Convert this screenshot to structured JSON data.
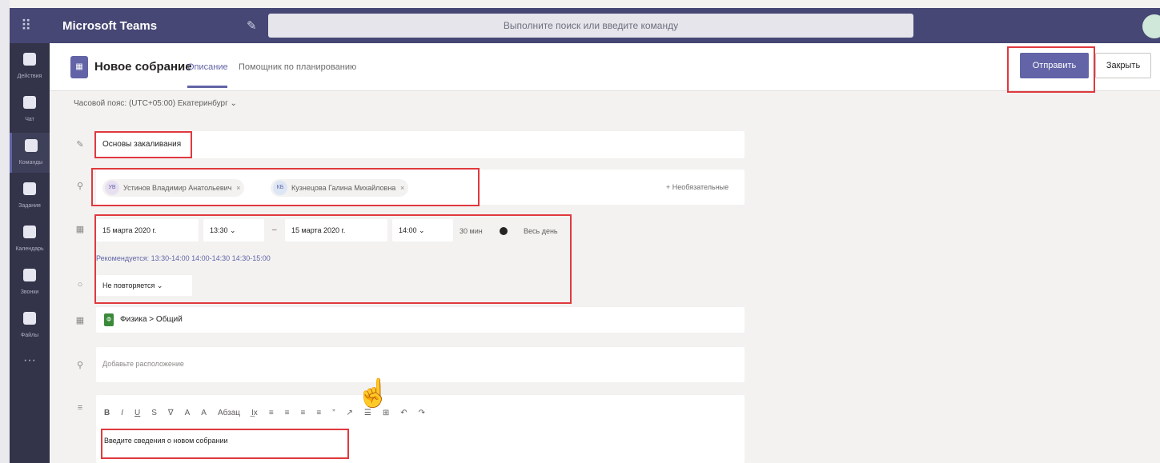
{
  "topbar": {
    "app_title": "Microsoft Teams",
    "search_placeholder": "Выполните поиск или введите команду"
  },
  "rail": {
    "items": [
      {
        "label": "Действия"
      },
      {
        "label": "Чат"
      },
      {
        "label": "Команды"
      },
      {
        "label": "Задания"
      },
      {
        "label": "Календарь"
      },
      {
        "label": "Звонки"
      },
      {
        "label": "Файлы"
      }
    ],
    "more": "···"
  },
  "header": {
    "title": "Новое собрание",
    "tabs": [
      "Описание",
      "Помощник по планированию"
    ],
    "send_label": "Отправить",
    "close_label": "Закрыть"
  },
  "timezone": "Часовой пояс: (UTC+05:00) Екатеринбург",
  "form": {
    "title_value": "Основы закаливания",
    "attendees": [
      {
        "initials": "УВ",
        "name": "Устинов Владимир Анатольевич"
      },
      {
        "initials": "КБ",
        "name": "Кузнецова Галина Михайловна"
      }
    ],
    "optional_label": "+ Необязательные",
    "start_date": "15 марта 2020 г.",
    "start_time": "13:30",
    "end_date": "15 марта 2020 г.",
    "end_time": "14:00",
    "duration": "30 мин",
    "all_day_label": "Весь день",
    "suggested_label": "Рекомендуется:",
    "suggested_times": "13:30-14:00  14:00-14:30  14:30-15:00",
    "repeat_value": "Не повторяется",
    "team": "Физика",
    "channel_separator": ">",
    "channel": "Общий",
    "location_placeholder": "Добавьте расположение",
    "editor_text": "Введите сведения о новом собрании"
  },
  "toolbar": [
    "B",
    "I",
    "U",
    "S",
    "∇",
    "A",
    "A",
    "Абзац",
    "I̲x",
    "≡",
    "≡",
    "≡",
    "≡",
    "”",
    "↗",
    "☰",
    "⊞",
    "↶",
    "↷"
  ],
  "colors": {
    "brand": "#6264a7",
    "topbar": "#464775",
    "rail": "#33344a",
    "highlight": "#e0393e"
  }
}
